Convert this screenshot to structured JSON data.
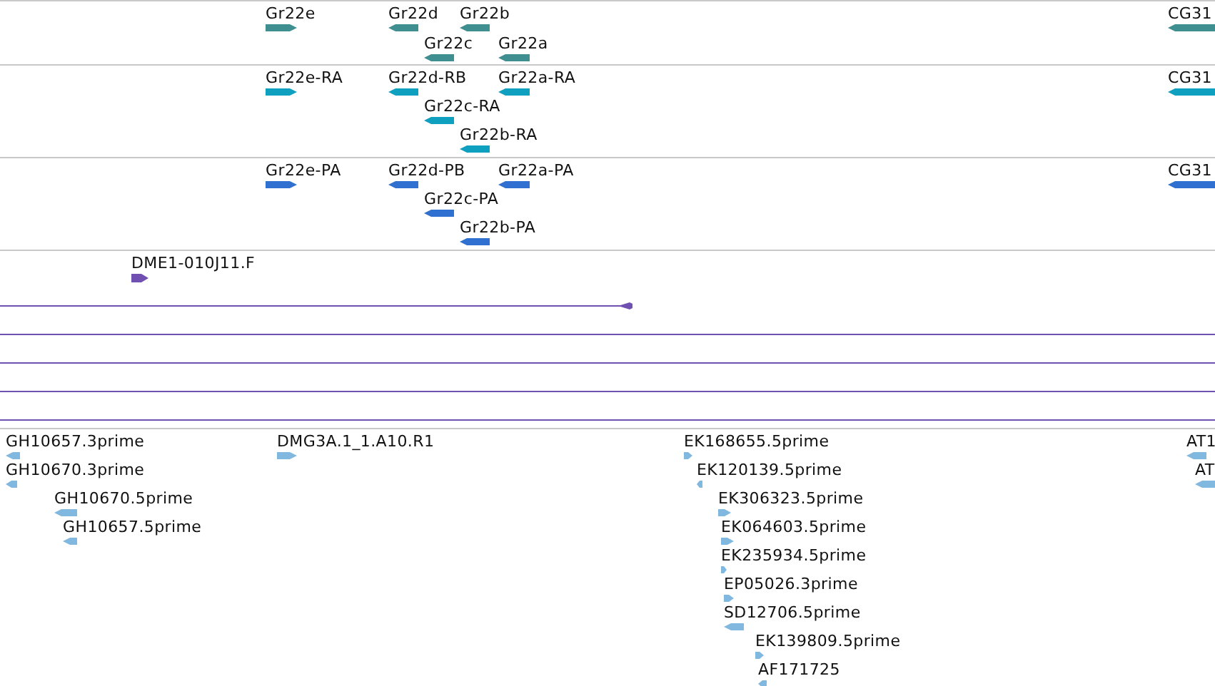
{
  "tracks": [
    {
      "color": "#3f8f90",
      "features": [
        {
          "label": "Gr22e",
          "reverse": false
        },
        {
          "label": "Gr22d",
          "reverse": true
        },
        {
          "label": "Gr22b",
          "reverse": true
        },
        {
          "label": "Gr22c",
          "reverse": true
        },
        {
          "label": "Gr22a",
          "reverse": true
        },
        {
          "label": "CG31",
          "reverse": true
        }
      ]
    },
    {
      "color": "#0fa0c0",
      "features": [
        {
          "label": "Gr22e-RA",
          "reverse": false
        },
        {
          "label": "Gr22d-RB",
          "reverse": true
        },
        {
          "label": "Gr22a-RA",
          "reverse": true
        },
        {
          "label": "Gr22c-RA",
          "reverse": true
        },
        {
          "label": "Gr22b-RA",
          "reverse": true
        },
        {
          "label": "CG31",
          "reverse": true
        }
      ]
    },
    {
      "color": "#3070d0",
      "features": [
        {
          "label": "Gr22e-PA",
          "reverse": false
        },
        {
          "label": "Gr22d-PB",
          "reverse": true
        },
        {
          "label": "Gr22a-PA",
          "reverse": true
        },
        {
          "label": "Gr22c-PA",
          "reverse": true
        },
        {
          "label": "Gr22b-PA",
          "reverse": true
        },
        {
          "label": "CG31",
          "reverse": true
        }
      ]
    },
    {
      "color": "#7050b0",
      "features": [
        {
          "kind": "box",
          "label": "DME1-010J11.F",
          "reverse": false
        },
        {
          "kind": "arrow_line",
          "reverse": true
        },
        {
          "kind": "line"
        },
        {
          "kind": "line"
        },
        {
          "kind": "line"
        },
        {
          "kind": "line"
        }
      ]
    },
    {
      "color": "#80b8e0",
      "features": [
        {
          "label": "GH10657.3prime",
          "reverse": true
        },
        {
          "label": "DMG3A.1_1.A10.R1",
          "reverse": false
        },
        {
          "label": "EK168655.5prime",
          "reverse": false
        },
        {
          "label": "AT1",
          "reverse": true
        },
        {
          "label": "GH10670.3prime",
          "reverse": true
        },
        {
          "label": "EK120139.5prime",
          "reverse": true
        },
        {
          "label": "AT",
          "reverse": true
        },
        {
          "label": "GH10670.5prime",
          "reverse": true
        },
        {
          "label": "EK306323.5prime",
          "reverse": false
        },
        {
          "label": "GH10657.5prime",
          "reverse": true
        },
        {
          "label": "EK064603.5prime",
          "reverse": false
        },
        {
          "label": "EK235934.5prime",
          "reverse": false
        },
        {
          "label": "EP05026.3prime",
          "reverse": false
        },
        {
          "label": "SD12706.5prime",
          "reverse": true
        },
        {
          "label": "EK139809.5prime",
          "reverse": false
        },
        {
          "label": "AF171725",
          "reverse": true
        }
      ]
    }
  ]
}
